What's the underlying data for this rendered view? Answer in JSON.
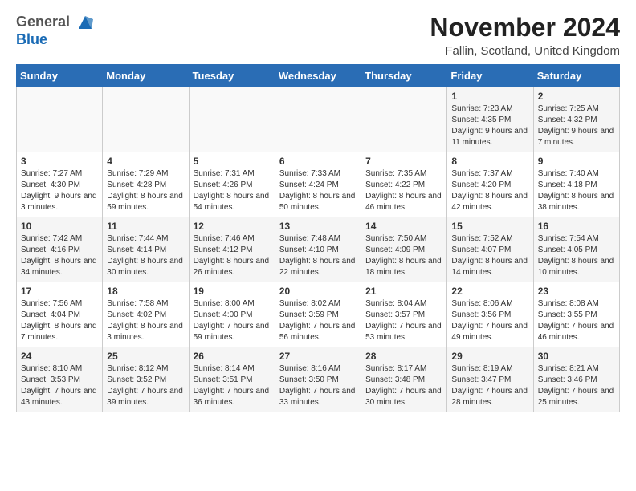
{
  "header": {
    "logo_general": "General",
    "logo_blue": "Blue",
    "month_title": "November 2024",
    "location": "Fallin, Scotland, United Kingdom"
  },
  "days_of_week": [
    "Sunday",
    "Monday",
    "Tuesday",
    "Wednesday",
    "Thursday",
    "Friday",
    "Saturday"
  ],
  "weeks": [
    [
      {
        "day": "",
        "info": ""
      },
      {
        "day": "",
        "info": ""
      },
      {
        "day": "",
        "info": ""
      },
      {
        "day": "",
        "info": ""
      },
      {
        "day": "",
        "info": ""
      },
      {
        "day": "1",
        "info": "Sunrise: 7:23 AM\nSunset: 4:35 PM\nDaylight: 9 hours and 11 minutes."
      },
      {
        "day": "2",
        "info": "Sunrise: 7:25 AM\nSunset: 4:32 PM\nDaylight: 9 hours and 7 minutes."
      }
    ],
    [
      {
        "day": "3",
        "info": "Sunrise: 7:27 AM\nSunset: 4:30 PM\nDaylight: 9 hours and 3 minutes."
      },
      {
        "day": "4",
        "info": "Sunrise: 7:29 AM\nSunset: 4:28 PM\nDaylight: 8 hours and 59 minutes."
      },
      {
        "day": "5",
        "info": "Sunrise: 7:31 AM\nSunset: 4:26 PM\nDaylight: 8 hours and 54 minutes."
      },
      {
        "day": "6",
        "info": "Sunrise: 7:33 AM\nSunset: 4:24 PM\nDaylight: 8 hours and 50 minutes."
      },
      {
        "day": "7",
        "info": "Sunrise: 7:35 AM\nSunset: 4:22 PM\nDaylight: 8 hours and 46 minutes."
      },
      {
        "day": "8",
        "info": "Sunrise: 7:37 AM\nSunset: 4:20 PM\nDaylight: 8 hours and 42 minutes."
      },
      {
        "day": "9",
        "info": "Sunrise: 7:40 AM\nSunset: 4:18 PM\nDaylight: 8 hours and 38 minutes."
      }
    ],
    [
      {
        "day": "10",
        "info": "Sunrise: 7:42 AM\nSunset: 4:16 PM\nDaylight: 8 hours and 34 minutes."
      },
      {
        "day": "11",
        "info": "Sunrise: 7:44 AM\nSunset: 4:14 PM\nDaylight: 8 hours and 30 minutes."
      },
      {
        "day": "12",
        "info": "Sunrise: 7:46 AM\nSunset: 4:12 PM\nDaylight: 8 hours and 26 minutes."
      },
      {
        "day": "13",
        "info": "Sunrise: 7:48 AM\nSunset: 4:10 PM\nDaylight: 8 hours and 22 minutes."
      },
      {
        "day": "14",
        "info": "Sunrise: 7:50 AM\nSunset: 4:09 PM\nDaylight: 8 hours and 18 minutes."
      },
      {
        "day": "15",
        "info": "Sunrise: 7:52 AM\nSunset: 4:07 PM\nDaylight: 8 hours and 14 minutes."
      },
      {
        "day": "16",
        "info": "Sunrise: 7:54 AM\nSunset: 4:05 PM\nDaylight: 8 hours and 10 minutes."
      }
    ],
    [
      {
        "day": "17",
        "info": "Sunrise: 7:56 AM\nSunset: 4:04 PM\nDaylight: 8 hours and 7 minutes."
      },
      {
        "day": "18",
        "info": "Sunrise: 7:58 AM\nSunset: 4:02 PM\nDaylight: 8 hours and 3 minutes."
      },
      {
        "day": "19",
        "info": "Sunrise: 8:00 AM\nSunset: 4:00 PM\nDaylight: 7 hours and 59 minutes."
      },
      {
        "day": "20",
        "info": "Sunrise: 8:02 AM\nSunset: 3:59 PM\nDaylight: 7 hours and 56 minutes."
      },
      {
        "day": "21",
        "info": "Sunrise: 8:04 AM\nSunset: 3:57 PM\nDaylight: 7 hours and 53 minutes."
      },
      {
        "day": "22",
        "info": "Sunrise: 8:06 AM\nSunset: 3:56 PM\nDaylight: 7 hours and 49 minutes."
      },
      {
        "day": "23",
        "info": "Sunrise: 8:08 AM\nSunset: 3:55 PM\nDaylight: 7 hours and 46 minutes."
      }
    ],
    [
      {
        "day": "24",
        "info": "Sunrise: 8:10 AM\nSunset: 3:53 PM\nDaylight: 7 hours and 43 minutes."
      },
      {
        "day": "25",
        "info": "Sunrise: 8:12 AM\nSunset: 3:52 PM\nDaylight: 7 hours and 39 minutes."
      },
      {
        "day": "26",
        "info": "Sunrise: 8:14 AM\nSunset: 3:51 PM\nDaylight: 7 hours and 36 minutes."
      },
      {
        "day": "27",
        "info": "Sunrise: 8:16 AM\nSunset: 3:50 PM\nDaylight: 7 hours and 33 minutes."
      },
      {
        "day": "28",
        "info": "Sunrise: 8:17 AM\nSunset: 3:48 PM\nDaylight: 7 hours and 30 minutes."
      },
      {
        "day": "29",
        "info": "Sunrise: 8:19 AM\nSunset: 3:47 PM\nDaylight: 7 hours and 28 minutes."
      },
      {
        "day": "30",
        "info": "Sunrise: 8:21 AM\nSunset: 3:46 PM\nDaylight: 7 hours and 25 minutes."
      }
    ]
  ]
}
